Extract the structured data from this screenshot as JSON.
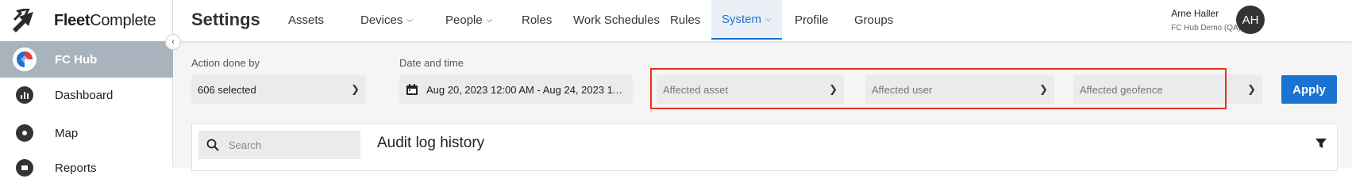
{
  "brand": {
    "name_bold": "Fleet",
    "name_rest": "Complete"
  },
  "sidebar": {
    "collapse_glyph": "‹",
    "active_item": {
      "label": "FC Hub",
      "icon": "fc-hub-icon"
    },
    "items": [
      {
        "label": "Dashboard",
        "icon": "dashboard-icon"
      },
      {
        "label": "Map",
        "icon": "map-pin-icon"
      },
      {
        "label": "Reports",
        "icon": "reports-icon"
      }
    ]
  },
  "header": {
    "title": "Settings",
    "tabs": [
      {
        "label": "Assets",
        "has_dropdown": false
      },
      {
        "label": "Devices",
        "has_dropdown": true
      },
      {
        "label": "People",
        "has_dropdown": true
      },
      {
        "label": "Roles",
        "has_dropdown": false
      },
      {
        "label": "Work Schedules",
        "has_dropdown": false
      },
      {
        "label": "Rules",
        "has_dropdown": false
      },
      {
        "label": "System",
        "has_dropdown": true,
        "active": true
      },
      {
        "label": "Profile",
        "has_dropdown": false
      },
      {
        "label": "Groups",
        "has_dropdown": false
      }
    ],
    "user": {
      "name": "Arne Haller",
      "org": "FC Hub Demo (QA)",
      "initials": "AH"
    }
  },
  "filters": {
    "action_done_by": {
      "label": "Action done by",
      "value": "606 selected"
    },
    "date_time": {
      "label": "Date and time",
      "value": "Aug 20, 2023 12:00 AM - Aug 24, 2023 11:..."
    },
    "affected_asset": {
      "placeholder": "Affected asset"
    },
    "affected_user": {
      "placeholder": "Affected user"
    },
    "affected_geofence": {
      "placeholder": "Affected geofence"
    },
    "apply_label": "Apply"
  },
  "audit_panel": {
    "search_placeholder": "Search",
    "title": "Audit log history"
  },
  "colors": {
    "accent": "#1a73d1",
    "highlight_border": "#e8311a",
    "sidebar_active_bg": "#a9b3bd"
  }
}
